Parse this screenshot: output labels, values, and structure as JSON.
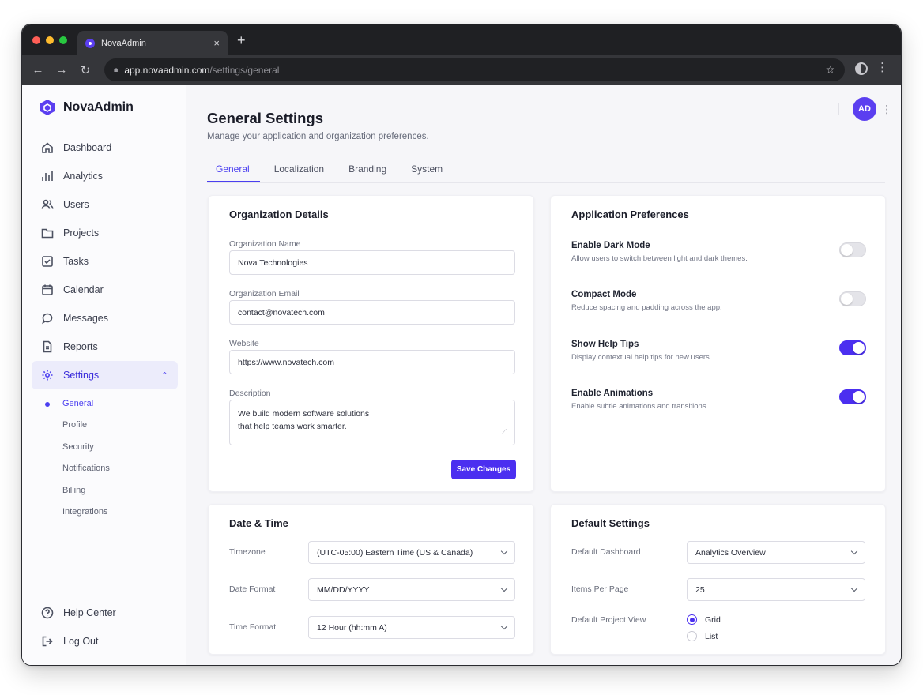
{
  "browser": {
    "tab_title": "NovaAdmin",
    "tab_close": "×",
    "new_tab": "+",
    "url_host": "app.novaadmin.com",
    "url_path": "/settings/general",
    "back": "←",
    "forward": "→",
    "reload": "↻",
    "star": "☆",
    "menu": "⋮"
  },
  "brand": {
    "name": "NovaAdmin",
    "color": "#5b3ff0"
  },
  "sidebar": {
    "items": [
      {
        "label": "Dashboard",
        "icon": "home-icon"
      },
      {
        "label": "Analytics",
        "icon": "bar-chart-icon"
      },
      {
        "label": "Users",
        "icon": "users-icon"
      },
      {
        "label": "Projects",
        "icon": "folder-icon"
      },
      {
        "label": "Tasks",
        "icon": "checkbox-icon"
      },
      {
        "label": "Calendar",
        "icon": "calendar-icon"
      },
      {
        "label": "Messages",
        "icon": "chat-icon"
      },
      {
        "label": "Reports",
        "icon": "document-icon"
      },
      {
        "label": "Settings",
        "icon": "gear-icon",
        "active": true,
        "chevron": "⌃"
      }
    ],
    "subitems": [
      {
        "label": "General",
        "active": true
      },
      {
        "label": "Profile"
      },
      {
        "label": "Security"
      },
      {
        "label": "Notifications"
      },
      {
        "label": "Billing"
      },
      {
        "label": "Integrations"
      }
    ],
    "bottom": [
      {
        "label": "Help Center",
        "icon": "help-icon"
      },
      {
        "label": "Log Out",
        "icon": "logout-icon"
      }
    ]
  },
  "header": {
    "avatar_initials": "AD",
    "kebab": "⋮",
    "title": "General Settings",
    "subtitle": "Manage your application and organization preferences."
  },
  "tabs": [
    "General",
    "Localization",
    "Branding",
    "System"
  ],
  "organization": {
    "title": "Organization Details",
    "name_label": "Organization Name",
    "name_value": "Nova Technologies",
    "email_label": "Organization Email",
    "email_value": "contact@novatech.com",
    "website_label": "Website",
    "website_value": "https://www.novatech.com",
    "description_label": "Description",
    "description_line1": "We build modern software solutions",
    "description_line2": "that help teams work smarter.",
    "save_label": "Save Changes"
  },
  "preferences": {
    "title": "Application Preferences",
    "items": [
      {
        "title": "Enable Dark Mode",
        "desc": "Allow users to switch between light and dark themes.",
        "on": false
      },
      {
        "title": "Compact Mode",
        "desc": "Reduce spacing and padding across the app.",
        "on": false
      },
      {
        "title": "Show Help Tips",
        "desc": "Display contextual help tips for new users.",
        "on": true
      },
      {
        "title": "Enable Animations",
        "desc": "Enable subtle animations and transitions.",
        "on": true
      }
    ]
  },
  "datetime": {
    "title": "Date & Time",
    "timezone_label": "Timezone",
    "timezone_value": "(UTC-05:00) Eastern Time (US & Canada)",
    "date_label": "Date Format",
    "date_value": "MM/DD/YYYY",
    "time_label": "Time Format",
    "time_value": "12 Hour (hh:mm A)"
  },
  "defaults": {
    "title": "Default Settings",
    "dashboard_label": "Default Dashboard",
    "dashboard_value": "Analytics Overview",
    "items_label": "Items Per Page",
    "items_value": "25",
    "view_label": "Default Project View",
    "view_options": [
      "Grid",
      "List"
    ],
    "view_selected": "Grid"
  },
  "colors": {
    "accent": "#4b2ff0",
    "active_bg": "#ececfb"
  }
}
